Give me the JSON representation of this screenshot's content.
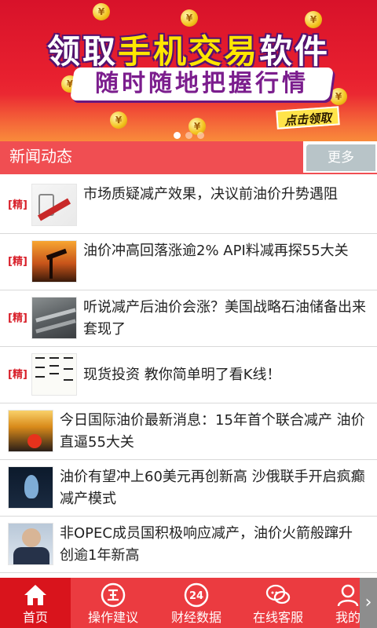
{
  "banner": {
    "title_part1": "领取",
    "title_highlight": "手机交易",
    "title_part2": "软件",
    "subtitle": "随时随地把握行情",
    "cta_label": "点击领取",
    "coin_glyph": "¥",
    "slide_count": 3,
    "active_slide": 0
  },
  "section": {
    "title": "新闻动态",
    "more_label": "更多"
  },
  "news": [
    {
      "tag": "[精]",
      "title": "市场质疑减产效果，决议前油价升势遇阻",
      "thumb": "price-chart-image"
    },
    {
      "tag": "[精]",
      "title": "油价冲高回落涨逾2% API料减再探55大关",
      "thumb": "oil-pump-sunset-image"
    },
    {
      "tag": "[精]",
      "title": "听说减产后油价会涨？美国战略石油储备出来套现了",
      "thumb": "oil-pipes-image"
    },
    {
      "tag": "[精]",
      "title": "现货投资 教你简单明了看K线！",
      "thumb": "calligraphy-image"
    },
    {
      "tag": "",
      "title": "今日国际油价最新消息：15年首个联合减产 油价直逼55大关",
      "thumb": "oil-barrel-image"
    },
    {
      "tag": "",
      "title": "油价有望冲上60美元再创新高 沙俄联手开启疯癫减产模式",
      "thumb": "oil-drop-image"
    },
    {
      "tag": "",
      "title": "非OPEC成员国积极响应减产，油价火箭般蹿升创逾1年新高",
      "thumb": "minister-portrait-image"
    }
  ],
  "nav": [
    {
      "label": "首页",
      "icon": "home-icon",
      "active": true
    },
    {
      "label": "操作建议",
      "icon": "advice-icon",
      "active": false
    },
    {
      "label": "财经数据",
      "icon": "clock-24-icon",
      "active": false
    },
    {
      "label": "在线客服",
      "icon": "chat-icon",
      "active": false
    },
    {
      "label": "我的",
      "icon": "user-icon",
      "active": false
    }
  ],
  "colors": {
    "brand_red": "#eb3b40",
    "active_red": "#d9141c",
    "header_red": "#f04e52",
    "more_gray": "#b8c4c8",
    "tag_red": "#d8202a"
  }
}
